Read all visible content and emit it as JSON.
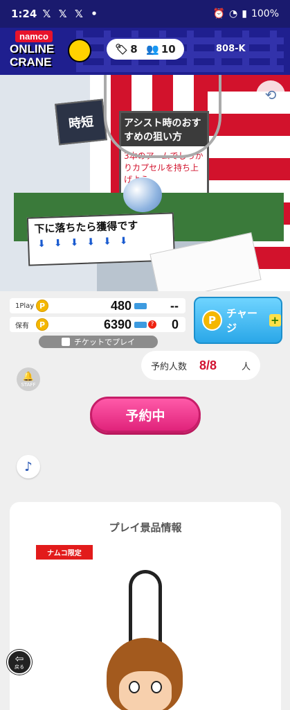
{
  "status_bar": {
    "time": "1:24",
    "notif_icons": "𝕏 𝕏 𝕏 •",
    "battery": "100%"
  },
  "header": {
    "logo_brand": "namco",
    "logo_line1": "ONLINE",
    "logo_line2": "CRANE",
    "tickets": "8",
    "viewers": "10",
    "machine_id": "808-K"
  },
  "video": {
    "sign_short": "時短",
    "sign_title": "アシスト時のおすすめの狙い方",
    "sign_body": "3本のアームでしっかりカプセルを持ち上げよう",
    "drop_sign": "下に落ちたら獲得です",
    "drop_arrows": "⬇⬇⬇⬇⬇⬇"
  },
  "play_info": {
    "row1_label": "1Play",
    "row1_value": "480",
    "row1_right": "--",
    "row2_label": "保有",
    "row2_value": "6390",
    "row2_right": "0",
    "coin_symbol": "P"
  },
  "charge_button": {
    "label": "チャージ",
    "coin_symbol": "P",
    "plus": "+"
  },
  "ticket_toggle": {
    "label": "チケットでプレイ"
  },
  "staff_button": {
    "label": "STAFF"
  },
  "reserve": {
    "label": "予約人数",
    "count": "8/8",
    "unit": "人"
  },
  "reserved_button": {
    "label": "予約中"
  },
  "music_button": {
    "symbol": "♪"
  },
  "prize": {
    "title": "プレイ景品情報",
    "badge": "ナムコ限定"
  },
  "back_button": {
    "label": "戻る"
  },
  "colors": {
    "header_bg": "#1f1f8f",
    "accent_pink": "#e0237b",
    "charge_blue": "#2aa7e8",
    "coin": "#f4b700"
  }
}
